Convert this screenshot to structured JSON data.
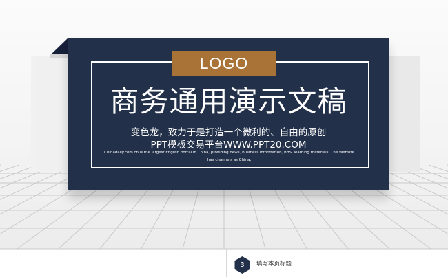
{
  "slide": {
    "logo_text": "LOGO",
    "title": "商务通用演示文稿",
    "subtitle_line1": "变色龙，致力于是打造一个微利的、自由的原创",
    "subtitle_line2": "PPT模板交易平台WWW.PPT20.COM",
    "description": "Chinadaily.com.cn is the largest English portal in China, providing news, business information, BBS, learning materials. The Website has channels as China,"
  },
  "footer": {
    "page_number": "3",
    "page_title": "填写本页标题"
  },
  "colors": {
    "panel": "#223049",
    "logo": "#a97337",
    "badge": "#223049"
  }
}
